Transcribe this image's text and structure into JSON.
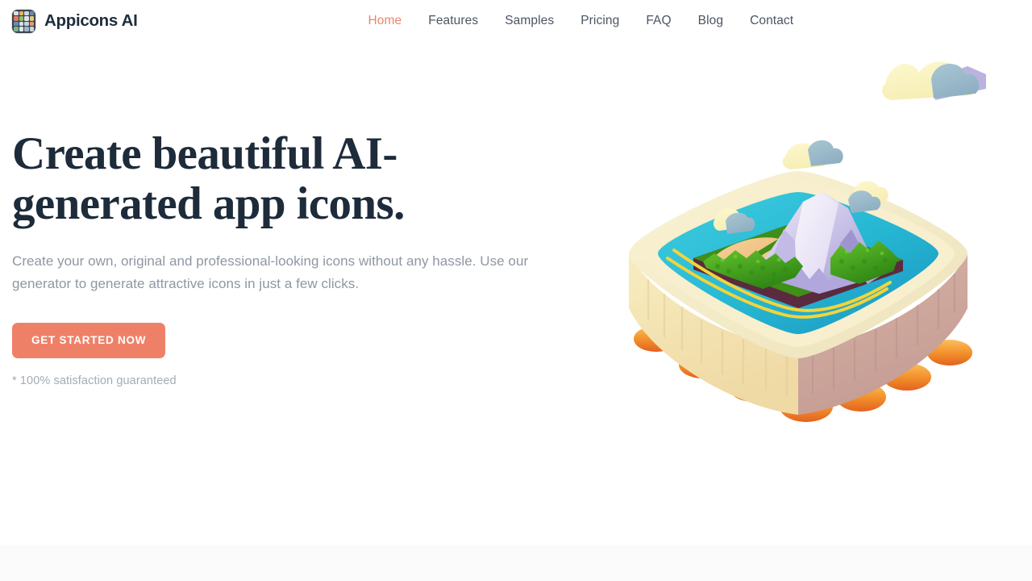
{
  "header": {
    "brand": {
      "name": "Appicons AI",
      "logo_icon": "app-icon-grid-icon",
      "logo_tile_colors": [
        "#d9e2ea",
        "#e8b45c",
        "#cfd8e0",
        "#6f8aa8",
        "#e07a5f",
        "#8fbf6b",
        "#dfe5eb",
        "#e8c97a",
        "#5f8fc2",
        "#d7dee6",
        "#c6d3de",
        "#e89b6a",
        "#7fb08a",
        "#dfe6ec",
        "#9fb6cc",
        "#cfd6dd"
      ]
    },
    "nav": [
      {
        "label": "Home",
        "active": true
      },
      {
        "label": "Features",
        "active": false
      },
      {
        "label": "Samples",
        "active": false
      },
      {
        "label": "Pricing",
        "active": false
      },
      {
        "label": "FAQ",
        "active": false
      },
      {
        "label": "Blog",
        "active": false
      },
      {
        "label": "Contact",
        "active": false
      }
    ]
  },
  "hero": {
    "title": "Create beautiful AI-generated app icons.",
    "subtitle": "Create your own, original and professional-looking icons without any hassle. Use our generator to generate attractive icons in just a few clicks.",
    "cta_label": "Get started now",
    "cta_note": "* 100% satisfaction guaranteed",
    "illustration_name": "isometric-island-diorama-illustration"
  },
  "colors": {
    "accent": "#ef8068",
    "accent_text": "#eb8570",
    "heading": "#1d2b3a",
    "body_text": "#8e97a3",
    "nav_text": "#4b5563",
    "note_text": "#a3abb7",
    "page_background": "#ffffff",
    "next_section_background": "#fbfbfc",
    "art_water": "#2dbdd4",
    "art_sand": "#f0c88a",
    "art_forest": "#4fa81f",
    "art_mountain": "#b3aede",
    "art_rim": "#f4ecc4",
    "art_base": "#cfa79c",
    "art_drip": "#f0922f"
  }
}
